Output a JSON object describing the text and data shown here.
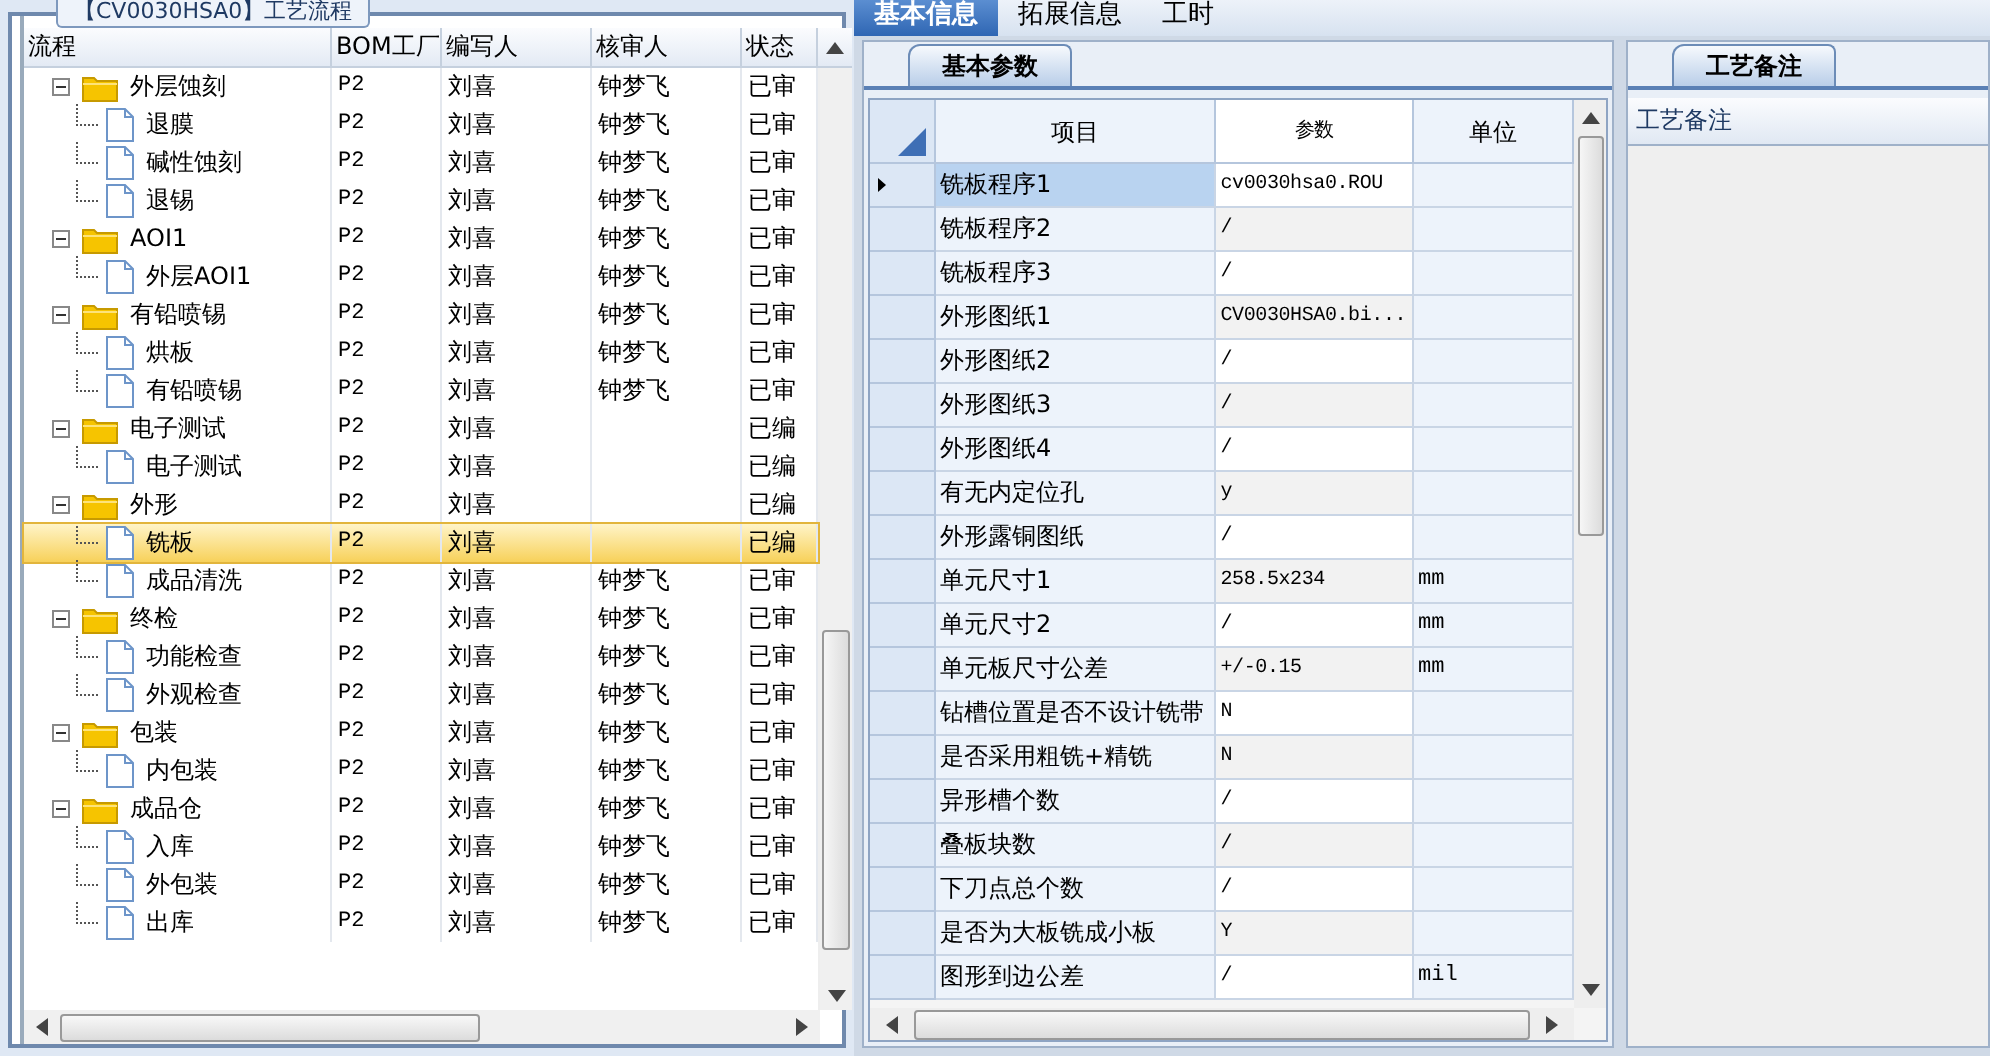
{
  "left_panel": {
    "title": "【CV0030HSA0】工艺流程",
    "columns": [
      "流程",
      "BOM工厂",
      "编写人",
      "核审人",
      "状态"
    ],
    "tree": [
      {
        "name": "外层蚀刻",
        "expanded": true,
        "factory": "P2",
        "author": "刘喜",
        "reviewer": "钟梦飞",
        "status": "已审",
        "selected": false,
        "children": [
          {
            "name": "退膜",
            "factory": "P2",
            "author": "刘喜",
            "reviewer": "钟梦飞",
            "status": "已审",
            "selected": false
          },
          {
            "name": "碱性蚀刻",
            "factory": "P2",
            "author": "刘喜",
            "reviewer": "钟梦飞",
            "status": "已审",
            "selected": false
          },
          {
            "name": "退锡",
            "factory": "P2",
            "author": "刘喜",
            "reviewer": "钟梦飞",
            "status": "已审",
            "selected": false
          }
        ]
      },
      {
        "name": "AOI1",
        "expanded": true,
        "factory": "P2",
        "author": "刘喜",
        "reviewer": "钟梦飞",
        "status": "已审",
        "selected": false,
        "children": [
          {
            "name": "外层AOI1",
            "factory": "P2",
            "author": "刘喜",
            "reviewer": "钟梦飞",
            "status": "已审",
            "selected": false
          }
        ]
      },
      {
        "name": "有铅喷锡",
        "expanded": true,
        "factory": "P2",
        "author": "刘喜",
        "reviewer": "钟梦飞",
        "status": "已审",
        "selected": false,
        "children": [
          {
            "name": "烘板",
            "factory": "P2",
            "author": "刘喜",
            "reviewer": "钟梦飞",
            "status": "已审",
            "selected": false
          },
          {
            "name": "有铅喷锡",
            "factory": "P2",
            "author": "刘喜",
            "reviewer": "钟梦飞",
            "status": "已审",
            "selected": false
          }
        ]
      },
      {
        "name": "电子测试",
        "expanded": true,
        "factory": "P2",
        "author": "刘喜",
        "status": "已编",
        "selected": false,
        "children": [
          {
            "name": "电子测试",
            "factory": "P2",
            "author": "刘喜",
            "status": "已编",
            "selected": false
          }
        ]
      },
      {
        "name": "外形",
        "expanded": true,
        "factory": "P2",
        "author": "刘喜",
        "status": "已编",
        "selected": false,
        "children": [
          {
            "name": "铣板",
            "factory": "P2",
            "author": "刘喜",
            "status": "已编",
            "selected": true
          },
          {
            "name": "成品清洗",
            "factory": "P2",
            "author": "刘喜",
            "reviewer": "钟梦飞",
            "status": "已审",
            "selected": false
          }
        ]
      },
      {
        "name": "终检",
        "expanded": true,
        "factory": "P2",
        "author": "刘喜",
        "reviewer": "钟梦飞",
        "status": "已审",
        "selected": false,
        "children": [
          {
            "name": "功能检查",
            "factory": "P2",
            "author": "刘喜",
            "reviewer": "钟梦飞",
            "status": "已审",
            "selected": false
          },
          {
            "name": "外观检查",
            "factory": "P2",
            "author": "刘喜",
            "reviewer": "钟梦飞",
            "status": "已审",
            "selected": false
          }
        ]
      },
      {
        "name": "包装",
        "expanded": true,
        "factory": "P2",
        "author": "刘喜",
        "reviewer": "钟梦飞",
        "status": "已审",
        "selected": false,
        "children": [
          {
            "name": "内包装",
            "factory": "P2",
            "author": "刘喜",
            "reviewer": "钟梦飞",
            "status": "已审",
            "selected": false
          }
        ]
      },
      {
        "name": "成品仓",
        "expanded": true,
        "factory": "P2",
        "author": "刘喜",
        "reviewer": "钟梦飞",
        "status": "已审",
        "selected": false,
        "children": [
          {
            "name": "入库",
            "factory": "P2",
            "author": "刘喜",
            "reviewer": "钟梦飞",
            "status": "已审",
            "selected": false
          },
          {
            "name": "外包装",
            "factory": "P2",
            "author": "刘喜",
            "reviewer": "钟梦飞",
            "status": "已审",
            "selected": false
          },
          {
            "name": "出库",
            "factory": "P2",
            "author": "刘喜",
            "reviewer": "钟梦飞",
            "status": "已审",
            "selected": false
          }
        ]
      }
    ]
  },
  "tabs": [
    {
      "label": "基本信息",
      "selected": true
    },
    {
      "label": "拓展信息",
      "selected": false
    },
    {
      "label": "工时",
      "selected": false
    }
  ],
  "params_panel": {
    "tab": "基本参数",
    "columns": [
      "项目",
      "参数",
      "单位"
    ],
    "rows": [
      {
        "item": "铣板程序1",
        "value": "cv0030hsa0.ROU",
        "selected": true
      },
      {
        "item": "铣板程序2",
        "value": "/",
        "selected": false
      },
      {
        "item": "铣板程序3",
        "value": "/",
        "selected": false
      },
      {
        "item": "外形图纸1",
        "value": "CV0030HSA0.bi...",
        "selected": false
      },
      {
        "item": "外形图纸2",
        "value": "/",
        "selected": false
      },
      {
        "item": "外形图纸3",
        "value": "/",
        "selected": false
      },
      {
        "item": "外形图纸4",
        "value": "/",
        "selected": false
      },
      {
        "item": "有无内定位孔",
        "value": "y",
        "selected": false
      },
      {
        "item": "外形露铜图纸",
        "value": "/",
        "selected": false
      },
      {
        "item": "单元尺寸1",
        "value": "258.5x234",
        "unit": "mm",
        "selected": false
      },
      {
        "item": "单元尺寸2",
        "value": "/",
        "unit": "mm",
        "selected": false
      },
      {
        "item": "单元板尺寸公差",
        "value": "+/-0.15",
        "unit": "mm",
        "selected": false
      },
      {
        "item": "钻槽位置是否不设计铣带",
        "value": "N",
        "selected": false
      },
      {
        "item": "是否采用粗铣+精铣",
        "value": "N",
        "selected": false
      },
      {
        "item": "异形槽个数",
        "value": "/",
        "selected": false
      },
      {
        "item": "叠板块数",
        "value": "/",
        "selected": false
      },
      {
        "item": "下刀点总个数",
        "value": "/",
        "selected": false
      },
      {
        "item": "是否为大板铣成小板",
        "value": "Y",
        "selected": false
      },
      {
        "item": "图形到边公差",
        "value": "/",
        "unit": "mil",
        "selected": false
      }
    ]
  },
  "notes_panel": {
    "tab": "工艺备注",
    "header": "工艺备注"
  }
}
